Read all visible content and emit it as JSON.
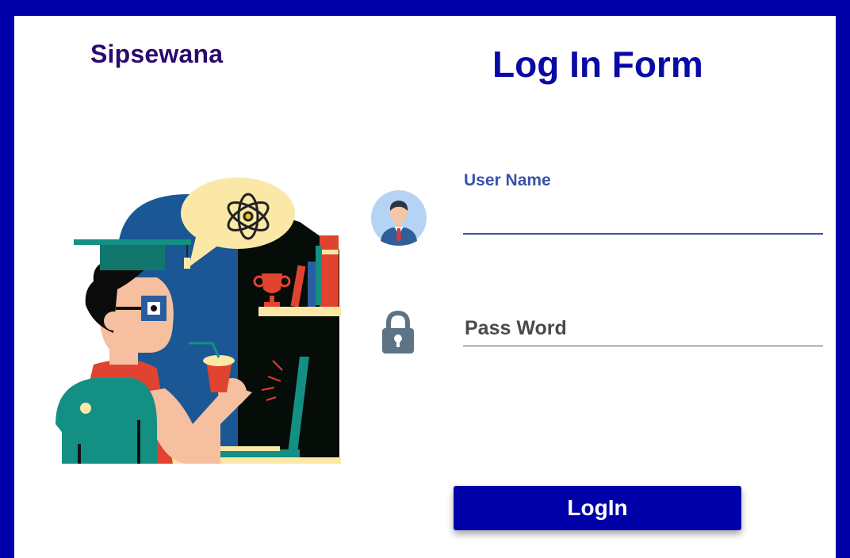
{
  "brand": {
    "name": "Sipsewana"
  },
  "form": {
    "title": "Log In Form",
    "username_label": "User Name",
    "username_value": "",
    "password_placeholder": "Pass Word",
    "login_label": "LogIn"
  },
  "colors": {
    "frame": "#0000a8",
    "title": "#0a0aa6",
    "brand": "#2a0a6e",
    "field_label": "#3a52a8",
    "button": "#0000a8"
  },
  "icons": {
    "user": "user-avatar-icon",
    "password": "lock-icon"
  }
}
